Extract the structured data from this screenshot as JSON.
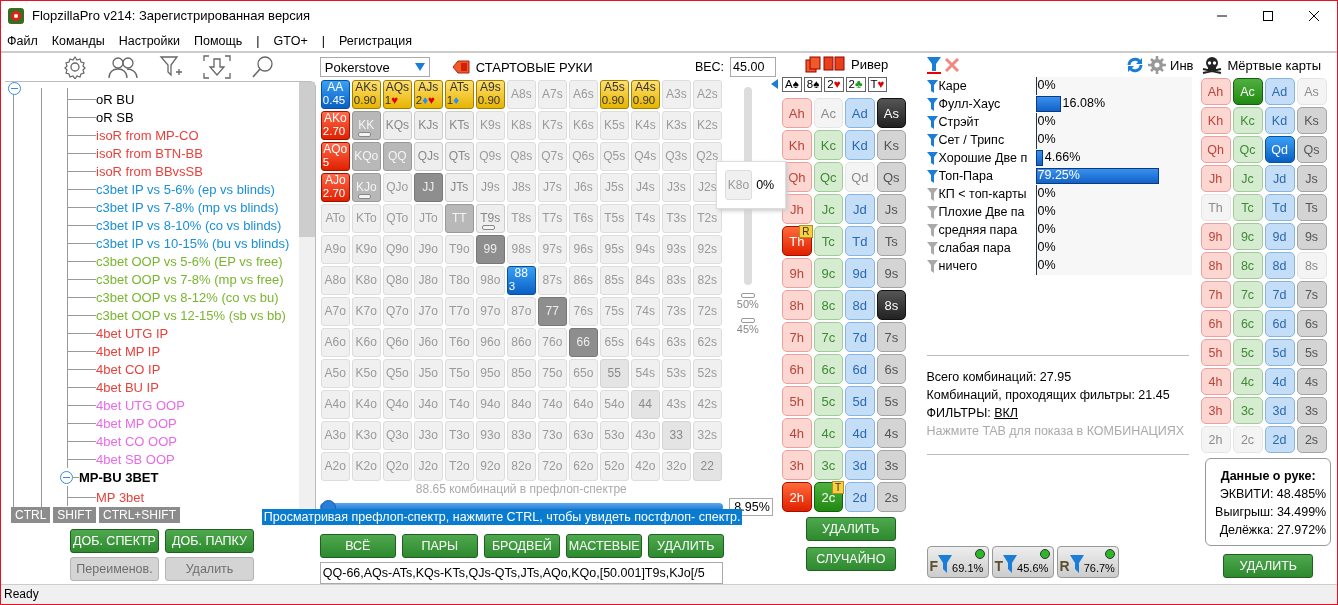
{
  "window": {
    "title": "FlopzillaPro v214: Зарегистрированная версия"
  },
  "menu": [
    "Файл",
    "Команды",
    "Настройки",
    "Помощь",
    "|",
    "GTO+",
    "|",
    "Регистрация"
  ],
  "tree": {
    "expanded": true,
    "groups": [
      {
        "children": [
          {
            "label": "oR BU",
            "color": "#000000"
          },
          {
            "label": "oR SB",
            "color": "#000000"
          },
          {
            "label": "isoR from MP-CO",
            "color": "#e8413c"
          },
          {
            "label": "isoR from BTN-BB",
            "color": "#e8413c"
          },
          {
            "label": "isoR from BBvsSB",
            "color": "#e8413c"
          },
          {
            "label": "c3bet IP vs 5-6% (ep vs blinds)",
            "color": "#1a8fd8"
          },
          {
            "label": "c3bet IP vs 7-8% (mp vs blinds)",
            "color": "#1a8fd8"
          },
          {
            "label": "c3bet IP vs 8-10% (co vs blinds)",
            "color": "#1a8fd8"
          },
          {
            "label": "c3bet IP vs 10-15% (bu vs blinds)",
            "color": "#1a8fd8"
          },
          {
            "label": "c3bet OOP vs 5-6% (EP vs free)",
            "color": "#7ab52f"
          },
          {
            "label": "c3bet OOP vs 7-8% (mp vs free)",
            "color": "#7ab52f"
          },
          {
            "label": "c3bet OOP vs 8-12% (co vs bu)",
            "color": "#7ab52f"
          },
          {
            "label": "c3bet OOP vs 12-15% (sb vs bb)",
            "color": "#7ab52f"
          },
          {
            "label": "4bet UTG IP",
            "color": "#e8413c"
          },
          {
            "label": "4bet MP IP",
            "color": "#e8413c"
          },
          {
            "label": "4bet CO IP",
            "color": "#e8413c"
          },
          {
            "label": "4bet BU IP",
            "color": "#e8413c"
          },
          {
            "label": "4bet UTG OOP",
            "color": "#e86ae8"
          },
          {
            "label": "4bet MP OOP",
            "color": "#e86ae8"
          },
          {
            "label": "4bet CO OOP",
            "color": "#e86ae8"
          },
          {
            "label": "4bet SB OOP",
            "color": "#e86ae8"
          }
        ]
      },
      {
        "label": "MP-BU 3BET",
        "expanded": true,
        "children": [
          {
            "label": "MP 3bet",
            "color": "#e8413c"
          }
        ]
      }
    ]
  },
  "modifier_tabs": [
    "CTRL",
    "SHIFT",
    "CTRL+SHIFT"
  ],
  "tree_buttons": [
    {
      "label": "ДОБ. СПЕКТР",
      "disabled": false
    },
    {
      "label": "ДОБ. ПАПКУ",
      "disabled": false
    },
    {
      "label": "Переименов.",
      "disabled": true
    },
    {
      "label": "Удалить",
      "disabled": true
    }
  ],
  "range": {
    "preset": "Pokerstove",
    "title": "СТАРТОВЫЕ РУКИ",
    "weight_label": "ВЕС:",
    "weight": "45.00",
    "grid": [
      [
        {
          "label": "AA",
          "kind": "sel",
          "sub": "0.45"
        },
        {
          "label": "AKs",
          "kind": "weight",
          "sub": "0.90"
        },
        {
          "label": "AQs",
          "kind": "weight",
          "sub": "1",
          "suits": [
            {
              "glyph": "♥",
              "color": "#e00000"
            }
          ]
        },
        {
          "label": "AJs",
          "kind": "weight",
          "sub": "2",
          "suits": [
            {
              "glyph": "♦",
              "color": "#1e90ff"
            },
            {
              "glyph": "♥",
              "color": "#e00000"
            }
          ]
        },
        {
          "label": "ATs",
          "kind": "weight",
          "sub": "1",
          "suits": [
            {
              "glyph": "♦",
              "color": "#1e90ff"
            }
          ]
        },
        {
          "label": "A9s",
          "kind": "weight",
          "sub": "0.90"
        },
        {
          "label": "A8s",
          "kind": "off"
        },
        {
          "label": "A7s",
          "kind": "off"
        },
        {
          "label": "A6s",
          "kind": "off"
        },
        {
          "label": "A5s",
          "kind": "weight",
          "sub": "0.90"
        },
        {
          "label": "A4s",
          "kind": "weight",
          "sub": "0.90"
        },
        {
          "label": "A3s",
          "kind": "off"
        },
        {
          "label": "A2s",
          "kind": "off"
        }
      ],
      [
        {
          "label": "AKo",
          "kind": "red",
          "sub": "2.70"
        },
        {
          "label": "KK",
          "kind": "mid",
          "partial": true
        },
        {
          "label": "KQs",
          "kind": "light"
        },
        {
          "label": "KJs",
          "kind": "light"
        },
        {
          "label": "KTs",
          "kind": "light"
        },
        {
          "label": "K9s",
          "kind": "off"
        },
        {
          "label": "K8s",
          "kind": "off"
        },
        {
          "label": "K7s",
          "kind": "off"
        },
        {
          "label": "K6s",
          "kind": "off"
        },
        {
          "label": "K5s",
          "kind": "off"
        },
        {
          "label": "K4s",
          "kind": "off"
        },
        {
          "label": "K3s",
          "kind": "off"
        },
        {
          "label": "K2s",
          "kind": "off"
        }
      ],
      [
        {
          "label": "AQo",
          "kind": "red",
          "sub": "5"
        },
        {
          "label": "KQo",
          "kind": "mid"
        },
        {
          "label": "QQ",
          "kind": "mid"
        },
        {
          "label": "QJs",
          "kind": "light"
        },
        {
          "label": "QTs",
          "kind": "light"
        },
        {
          "label": "Q9s",
          "kind": "off"
        },
        {
          "label": "Q8s",
          "kind": "off"
        },
        {
          "label": "Q7s",
          "kind": "off"
        },
        {
          "label": "Q6s",
          "kind": "off"
        },
        {
          "label": "Q5s",
          "kind": "off"
        },
        {
          "label": "Q4s",
          "kind": "off"
        },
        {
          "label": "Q3s",
          "kind": "off"
        },
        {
          "label": "Q2s",
          "kind": "off"
        }
      ],
      [
        {
          "label": "AJo",
          "kind": "red",
          "sub": "2.70"
        },
        {
          "label": "KJo",
          "kind": "mid",
          "partial": true
        },
        {
          "label": "QJo",
          "kind": "off"
        },
        {
          "label": "JJ",
          "kind": "dark"
        },
        {
          "label": "JTs",
          "kind": "light"
        },
        {
          "label": "J9s",
          "kind": "off"
        },
        {
          "label": "J8s",
          "kind": "off"
        },
        {
          "label": "J7s",
          "kind": "off"
        },
        {
          "label": "J6s",
          "kind": "off"
        },
        {
          "label": "J5s",
          "kind": "off"
        },
        {
          "label": "J4s",
          "kind": "off"
        },
        {
          "label": "J3s",
          "kind": "off"
        },
        {
          "label": "J2s",
          "kind": "off"
        }
      ],
      [
        {
          "label": "ATo",
          "kind": "off"
        },
        {
          "label": "KTo",
          "kind": "off"
        },
        {
          "label": "QTo",
          "kind": "off"
        },
        {
          "label": "JTo",
          "kind": "off"
        },
        {
          "label": "TT",
          "kind": "mid"
        },
        {
          "label": "T9s",
          "kind": "light",
          "partial": true
        },
        {
          "label": "T8s",
          "kind": "off"
        },
        {
          "label": "T7s",
          "kind": "off"
        },
        {
          "label": "T6s",
          "kind": "off"
        },
        {
          "label": "T5s",
          "kind": "off"
        },
        {
          "label": "T4s",
          "kind": "off"
        },
        {
          "label": "T3s",
          "kind": "off"
        },
        {
          "label": "T2s",
          "kind": "off"
        }
      ],
      [
        {
          "label": "A9o",
          "kind": "off"
        },
        {
          "label": "K9o",
          "kind": "off"
        },
        {
          "label": "Q9o",
          "kind": "off"
        },
        {
          "label": "J9o",
          "kind": "off"
        },
        {
          "label": "T9o",
          "kind": "off"
        },
        {
          "label": "99",
          "kind": "dark"
        },
        {
          "label": "98s",
          "kind": "off"
        },
        {
          "label": "97s",
          "kind": "off"
        },
        {
          "label": "96s",
          "kind": "off"
        },
        {
          "label": "95s",
          "kind": "off"
        },
        {
          "label": "94s",
          "kind": "off"
        },
        {
          "label": "93s",
          "kind": "off"
        },
        {
          "label": "92s",
          "kind": "off"
        }
      ],
      [
        {
          "label": "A8o",
          "kind": "off"
        },
        {
          "label": "K8o",
          "kind": "off"
        },
        {
          "label": "Q8o",
          "kind": "off"
        },
        {
          "label": "J8o",
          "kind": "off"
        },
        {
          "label": "T8o",
          "kind": "off"
        },
        {
          "label": "98o",
          "kind": "off"
        },
        {
          "label": "88",
          "kind": "sel",
          "sub": "3"
        },
        {
          "label": "87s",
          "kind": "off"
        },
        {
          "label": "86s",
          "kind": "off"
        },
        {
          "label": "85s",
          "kind": "off"
        },
        {
          "label": "84s",
          "kind": "off"
        },
        {
          "label": "83s",
          "kind": "off"
        },
        {
          "label": "82s",
          "kind": "off"
        }
      ],
      [
        {
          "label": "A7o",
          "kind": "off"
        },
        {
          "label": "K7o",
          "kind": "off"
        },
        {
          "label": "Q7o",
          "kind": "off"
        },
        {
          "label": "J7o",
          "kind": "off"
        },
        {
          "label": "T7o",
          "kind": "off"
        },
        {
          "label": "97o",
          "kind": "off"
        },
        {
          "label": "87o",
          "kind": "off"
        },
        {
          "label": "77",
          "kind": "dark"
        },
        {
          "label": "76s",
          "kind": "off"
        },
        {
          "label": "75s",
          "kind": "off"
        },
        {
          "label": "74s",
          "kind": "off"
        },
        {
          "label": "73s",
          "kind": "off"
        },
        {
          "label": "72s",
          "kind": "off"
        }
      ],
      [
        {
          "label": "A6o",
          "kind": "off"
        },
        {
          "label": "K6o",
          "kind": "off"
        },
        {
          "label": "Q6o",
          "kind": "off"
        },
        {
          "label": "J6o",
          "kind": "off"
        },
        {
          "label": "T6o",
          "kind": "off"
        },
        {
          "label": "96o",
          "kind": "off"
        },
        {
          "label": "86o",
          "kind": "off"
        },
        {
          "label": "76o",
          "kind": "off"
        },
        {
          "label": "66",
          "kind": "dark"
        },
        {
          "label": "65s",
          "kind": "off"
        },
        {
          "label": "64s",
          "kind": "off"
        },
        {
          "label": "63s",
          "kind": "off"
        },
        {
          "label": "62s",
          "kind": "off"
        }
      ],
      [
        {
          "label": "A5o",
          "kind": "off"
        },
        {
          "label": "K5o",
          "kind": "off"
        },
        {
          "label": "Q5o",
          "kind": "off"
        },
        {
          "label": "J5o",
          "kind": "off"
        },
        {
          "label": "T5o",
          "kind": "off"
        },
        {
          "label": "95o",
          "kind": "off"
        },
        {
          "label": "85o",
          "kind": "off"
        },
        {
          "label": "75o",
          "kind": "off"
        },
        {
          "label": "65o",
          "kind": "off"
        },
        {
          "label": "55",
          "kind": "pair"
        },
        {
          "label": "54s",
          "kind": "off"
        },
        {
          "label": "53s",
          "kind": "off"
        },
        {
          "label": "52s",
          "kind": "off"
        }
      ],
      [
        {
          "label": "A4o",
          "kind": "off"
        },
        {
          "label": "K4o",
          "kind": "off"
        },
        {
          "label": "Q4o",
          "kind": "off"
        },
        {
          "label": "J4o",
          "kind": "off"
        },
        {
          "label": "T4o",
          "kind": "off"
        },
        {
          "label": "94o",
          "kind": "off"
        },
        {
          "label": "84o",
          "kind": "off"
        },
        {
          "label": "74o",
          "kind": "off"
        },
        {
          "label": "64o",
          "kind": "off"
        },
        {
          "label": "54o",
          "kind": "off"
        },
        {
          "label": "44",
          "kind": "pair"
        },
        {
          "label": "43s",
          "kind": "off"
        },
        {
          "label": "42s",
          "kind": "off"
        }
      ],
      [
        {
          "label": "A3o",
          "kind": "off"
        },
        {
          "label": "K3o",
          "kind": "off"
        },
        {
          "label": "Q3o",
          "kind": "off"
        },
        {
          "label": "J3o",
          "kind": "off"
        },
        {
          "label": "T3o",
          "kind": "off"
        },
        {
          "label": "93o",
          "kind": "off"
        },
        {
          "label": "83o",
          "kind": "off"
        },
        {
          "label": "73o",
          "kind": "off"
        },
        {
          "label": "63o",
          "kind": "off"
        },
        {
          "label": "53o",
          "kind": "off"
        },
        {
          "label": "43o",
          "kind": "off"
        },
        {
          "label": "33",
          "kind": "pair"
        },
        {
          "label": "32s",
          "kind": "off"
        }
      ],
      [
        {
          "label": "A2o",
          "kind": "off"
        },
        {
          "label": "K2o",
          "kind": "off"
        },
        {
          "label": "Q2o",
          "kind": "off"
        },
        {
          "label": "J2o",
          "kind": "off"
        },
        {
          "label": "T2o",
          "kind": "off"
        },
        {
          "label": "92o",
          "kind": "off"
        },
        {
          "label": "82o",
          "kind": "off"
        },
        {
          "label": "72o",
          "kind": "off"
        },
        {
          "label": "62o",
          "kind": "off"
        },
        {
          "label": "52o",
          "kind": "off"
        },
        {
          "label": "42o",
          "kind": "off"
        },
        {
          "label": "32o",
          "kind": "off"
        },
        {
          "label": "22",
          "kind": "pair"
        }
      ]
    ],
    "weight_marks": [
      "50%",
      "45%"
    ],
    "combos_caption": "88.65 комбинаций в префлоп-спектре",
    "slider": {
      "level": 0.02
    },
    "percent": "8.95%",
    "hint": "Просматривая префлоп-спектр, нажмите CTRL, чтобы увидеть постфлоп- спектр.",
    "buttons": [
      "ВСЁ",
      "ПАРЫ",
      "БРОДВЕЙ",
      "МАСТЕВЫЕ",
      "УДАЛИТЬ"
    ],
    "text": "QQ-66,AQs-ATs,KQs-KTs,QJs-QTs,JTs,AQo,KQo,[50.001]T9s,KJo[/5",
    "popup": {
      "hand": "K8o",
      "value": "0%"
    }
  },
  "board": {
    "street": "Ривер",
    "cards": [
      {
        "rank": "A",
        "suit": "♠",
        "color": "#000000"
      },
      {
        "rank": "8",
        "suit": "♠",
        "color": "#000000"
      },
      {
        "rank": "2",
        "suit": "♥",
        "color": "#e00000"
      },
      {
        "rank": "2",
        "suit": "♣",
        "color": "#1a9a1a"
      },
      {
        "rank": "T",
        "suit": "♥",
        "color": "#e00000"
      }
    ],
    "deck": [
      [
        {
          "label": "Ah",
          "kind": "h",
          "selected": false,
          "used": false
        },
        {
          "label": "Ac",
          "kind": "c",
          "selected": false,
          "used": true
        },
        {
          "label": "Ad",
          "kind": "d",
          "selected": false,
          "used": false
        },
        {
          "label": "As",
          "kind": "s",
          "selected": true,
          "used": false
        }
      ],
      [
        {
          "label": "Kh",
          "kind": "h",
          "selected": false,
          "used": false
        },
        {
          "label": "Kc",
          "kind": "c",
          "selected": false,
          "used": false
        },
        {
          "label": "Kd",
          "kind": "d",
          "selected": false,
          "used": false
        },
        {
          "label": "Ks",
          "kind": "s",
          "selected": false,
          "used": false
        }
      ],
      [
        {
          "label": "Qh",
          "kind": "h",
          "selected": false,
          "used": false
        },
        {
          "label": "Qc",
          "kind": "c",
          "selected": false,
          "used": false
        },
        {
          "label": "Qd",
          "kind": "d",
          "selected": false,
          "used": true
        },
        {
          "label": "Qs",
          "kind": "s",
          "selected": false,
          "used": false
        }
      ],
      [
        {
          "label": "Jh",
          "kind": "h",
          "selected": false,
          "used": false
        },
        {
          "label": "Jc",
          "kind": "c",
          "selected": false,
          "used": false
        },
        {
          "label": "Jd",
          "kind": "d",
          "selected": false,
          "used": false
        },
        {
          "label": "Js",
          "kind": "s",
          "selected": false,
          "used": false
        }
      ],
      [
        {
          "label": "Th",
          "kind": "h",
          "selected": true,
          "used": false,
          "badge": "R"
        },
        {
          "label": "Tc",
          "kind": "c",
          "selected": false,
          "used": false
        },
        {
          "label": "Td",
          "kind": "d",
          "selected": false,
          "used": false
        },
        {
          "label": "Ts",
          "kind": "s",
          "selected": false,
          "used": false
        }
      ],
      [
        {
          "label": "9h",
          "kind": "h",
          "selected": false,
          "used": false
        },
        {
          "label": "9c",
          "kind": "c",
          "selected": false,
          "used": false
        },
        {
          "label": "9d",
          "kind": "d",
          "selected": false,
          "used": false
        },
        {
          "label": "9s",
          "kind": "s",
          "selected": false,
          "used": false
        }
      ],
      [
        {
          "label": "8h",
          "kind": "h",
          "selected": false,
          "used": false
        },
        {
          "label": "8c",
          "kind": "c",
          "selected": false,
          "used": false
        },
        {
          "label": "8d",
          "kind": "d",
          "selected": false,
          "used": false
        },
        {
          "label": "8s",
          "kind": "s",
          "selected": true,
          "used": false
        }
      ],
      [
        {
          "label": "7h",
          "kind": "h",
          "selected": false,
          "used": false
        },
        {
          "label": "7c",
          "kind": "c",
          "selected": false,
          "used": false
        },
        {
          "label": "7d",
          "kind": "d",
          "selected": false,
          "used": false
        },
        {
          "label": "7s",
          "kind": "s",
          "selected": false,
          "used": false
        }
      ],
      [
        {
          "label": "6h",
          "kind": "h",
          "selected": false,
          "used": false
        },
        {
          "label": "6c",
          "kind": "c",
          "selected": false,
          "used": false
        },
        {
          "label": "6d",
          "kind": "d",
          "selected": false,
          "used": false
        },
        {
          "label": "6s",
          "kind": "s",
          "selected": false,
          "used": false
        }
      ],
      [
        {
          "label": "5h",
          "kind": "h",
          "selected": false,
          "used": false
        },
        {
          "label": "5c",
          "kind": "c",
          "selected": false,
          "used": false
        },
        {
          "label": "5d",
          "kind": "d",
          "selected": false,
          "used": false
        },
        {
          "label": "5s",
          "kind": "s",
          "selected": false,
          "used": false
        }
      ],
      [
        {
          "label": "4h",
          "kind": "h",
          "selected": false,
          "used": false
        },
        {
          "label": "4c",
          "kind": "c",
          "selected": false,
          "used": false
        },
        {
          "label": "4d",
          "kind": "d",
          "selected": false,
          "used": false
        },
        {
          "label": "4s",
          "kind": "s",
          "selected": false,
          "used": false
        }
      ],
      [
        {
          "label": "3h",
          "kind": "h",
          "selected": false,
          "used": false
        },
        {
          "label": "3c",
          "kind": "c",
          "selected": false,
          "used": false
        },
        {
          "label": "3d",
          "kind": "d",
          "selected": false,
          "used": false
        },
        {
          "label": "3s",
          "kind": "s",
          "selected": false,
          "used": false
        }
      ],
      [
        {
          "label": "2h",
          "kind": "h",
          "selected": true,
          "used": false
        },
        {
          "label": "2c",
          "kind": "c",
          "selected": true,
          "used": false,
          "badge": "T"
        },
        {
          "label": "2d",
          "kind": "d",
          "selected": false,
          "used": false
        },
        {
          "label": "2s",
          "kind": "s",
          "selected": false,
          "used": false
        }
      ]
    ],
    "buttons": [
      "УДАЛИТЬ",
      "СЛУЧАЙНО"
    ]
  },
  "stats": {
    "invert_label": "Инв",
    "categories": [
      {
        "name": "Каре",
        "active": true,
        "level": 0,
        "value": "0%"
      },
      {
        "name": "Фулл-Хаус",
        "active": true,
        "level": 0.1608,
        "value": "16.08%"
      },
      {
        "name": "Стрэйт",
        "active": true,
        "level": 0,
        "value": "0%"
      },
      {
        "name": "Сет / Трипс",
        "active": true,
        "level": 0,
        "value": "0%"
      },
      {
        "name": "Хорошие Две п",
        "active": true,
        "level": 0.0466,
        "value": "4.66%"
      },
      {
        "name": "Топ-Пара",
        "active": true,
        "level": 0.7925,
        "value": "79.25%"
      },
      {
        "name": "КП < топ-карты",
        "active": false,
        "level": 0,
        "value": "0%"
      },
      {
        "name": "Плохие Две па",
        "active": false,
        "level": 0,
        "value": "0%"
      },
      {
        "name": "средняя пара",
        "active": false,
        "level": 0,
        "value": "0%"
      },
      {
        "name": "слабая пара",
        "active": false,
        "level": 0,
        "value": "0%"
      },
      {
        "name": "ничего",
        "active": false,
        "level": 0,
        "value": "0%"
      }
    ],
    "total": "Всего комбинаций: 27.95",
    "passing": "Комбинаций, проходящих фильтры: 21.45",
    "filters_label": "ФИЛЬТРЫ:",
    "filters_link": "ВКЛ",
    "tab_hint": "Нажмите TAB для показа в КОМБИНАЦИЯХ",
    "street_filters": [
      {
        "letter": "F",
        "value": "69.1%",
        "on": true
      },
      {
        "letter": "T",
        "value": "45.6%",
        "on": true
      },
      {
        "letter": "R",
        "value": "76.7%",
        "on": true
      }
    ]
  },
  "dead": {
    "title": "Мёртвые карты",
    "deck": [
      [
        {
          "label": "Ah",
          "kind": "h",
          "selected": false,
          "used": false
        },
        {
          "label": "Ac",
          "kind": "c",
          "selected": true,
          "used": false
        },
        {
          "label": "Ad",
          "kind": "d",
          "selected": false,
          "used": false
        },
        {
          "label": "As",
          "kind": "s",
          "selected": false,
          "used": true
        }
      ],
      [
        {
          "label": "Kh",
          "kind": "h",
          "selected": false,
          "used": false
        },
        {
          "label": "Kc",
          "kind": "c",
          "selected": false,
          "used": false
        },
        {
          "label": "Kd",
          "kind": "d",
          "selected": false,
          "used": false
        },
        {
          "label": "Ks",
          "kind": "s",
          "selected": false,
          "used": false
        }
      ],
      [
        {
          "label": "Qh",
          "kind": "h",
          "selected": false,
          "used": false
        },
        {
          "label": "Qc",
          "kind": "c",
          "selected": false,
          "used": false
        },
        {
          "label": "Qd",
          "kind": "d",
          "selected": true,
          "used": false
        },
        {
          "label": "Qs",
          "kind": "s",
          "selected": false,
          "used": false
        }
      ],
      [
        {
          "label": "Jh",
          "kind": "h",
          "selected": false,
          "used": false
        },
        {
          "label": "Jc",
          "kind": "c",
          "selected": false,
          "used": false
        },
        {
          "label": "Jd",
          "kind": "d",
          "selected": false,
          "used": false
        },
        {
          "label": "Js",
          "kind": "s",
          "selected": false,
          "used": false
        }
      ],
      [
        {
          "label": "Th",
          "kind": "h",
          "selected": false,
          "used": true
        },
        {
          "label": "Tc",
          "kind": "c",
          "selected": false,
          "used": false
        },
        {
          "label": "Td",
          "kind": "d",
          "selected": false,
          "used": false
        },
        {
          "label": "Ts",
          "kind": "s",
          "selected": false,
          "used": false
        }
      ],
      [
        {
          "label": "9h",
          "kind": "h",
          "selected": false,
          "used": false
        },
        {
          "label": "9c",
          "kind": "c",
          "selected": false,
          "used": false
        },
        {
          "label": "9d",
          "kind": "d",
          "selected": false,
          "used": false
        },
        {
          "label": "9s",
          "kind": "s",
          "selected": false,
          "used": false
        }
      ],
      [
        {
          "label": "8h",
          "kind": "h",
          "selected": false,
          "used": false
        },
        {
          "label": "8c",
          "kind": "c",
          "selected": false,
          "used": false
        },
        {
          "label": "8d",
          "kind": "d",
          "selected": false,
          "used": false
        },
        {
          "label": "8s",
          "kind": "s",
          "selected": false,
          "used": true
        }
      ],
      [
        {
          "label": "7h",
          "kind": "h",
          "selected": false,
          "used": false
        },
        {
          "label": "7c",
          "kind": "c",
          "selected": false,
          "used": false
        },
        {
          "label": "7d",
          "kind": "d",
          "selected": false,
          "used": false
        },
        {
          "label": "7s",
          "kind": "s",
          "selected": false,
          "used": false
        }
      ],
      [
        {
          "label": "6h",
          "kind": "h",
          "selected": false,
          "used": false
        },
        {
          "label": "6c",
          "kind": "c",
          "selected": false,
          "used": false
        },
        {
          "label": "6d",
          "kind": "d",
          "selected": false,
          "used": false
        },
        {
          "label": "6s",
          "kind": "s",
          "selected": false,
          "used": false
        }
      ],
      [
        {
          "label": "5h",
          "kind": "h",
          "selected": false,
          "used": false
        },
        {
          "label": "5c",
          "kind": "c",
          "selected": false,
          "used": false
        },
        {
          "label": "5d",
          "kind": "d",
          "selected": false,
          "used": false
        },
        {
          "label": "5s",
          "kind": "s",
          "selected": false,
          "used": false
        }
      ],
      [
        {
          "label": "4h",
          "kind": "h",
          "selected": false,
          "used": false
        },
        {
          "label": "4c",
          "kind": "c",
          "selected": false,
          "used": false
        },
        {
          "label": "4d",
          "kind": "d",
          "selected": false,
          "used": false
        },
        {
          "label": "4s",
          "kind": "s",
          "selected": false,
          "used": false
        }
      ],
      [
        {
          "label": "3h",
          "kind": "h",
          "selected": false,
          "used": false
        },
        {
          "label": "3c",
          "kind": "c",
          "selected": false,
          "used": false
        },
        {
          "label": "3d",
          "kind": "d",
          "selected": false,
          "used": false
        },
        {
          "label": "3s",
          "kind": "s",
          "selected": false,
          "used": false
        }
      ],
      [
        {
          "label": "2h",
          "kind": "h",
          "selected": false,
          "used": true
        },
        {
          "label": "2c",
          "kind": "c",
          "selected": false,
          "used": true
        },
        {
          "label": "2d",
          "kind": "d",
          "selected": false,
          "used": false
        },
        {
          "label": "2s",
          "kind": "s",
          "selected": false,
          "used": false
        }
      ]
    ],
    "hand_title": "Данные о руке:",
    "hand_rows": [
      "ЭКВИТИ: 48.485%",
      "Выигрыш: 34.499%",
      "Делёжка: 27.972%"
    ],
    "button": "УДАЛИТЬ"
  },
  "status_bar": "Ready"
}
